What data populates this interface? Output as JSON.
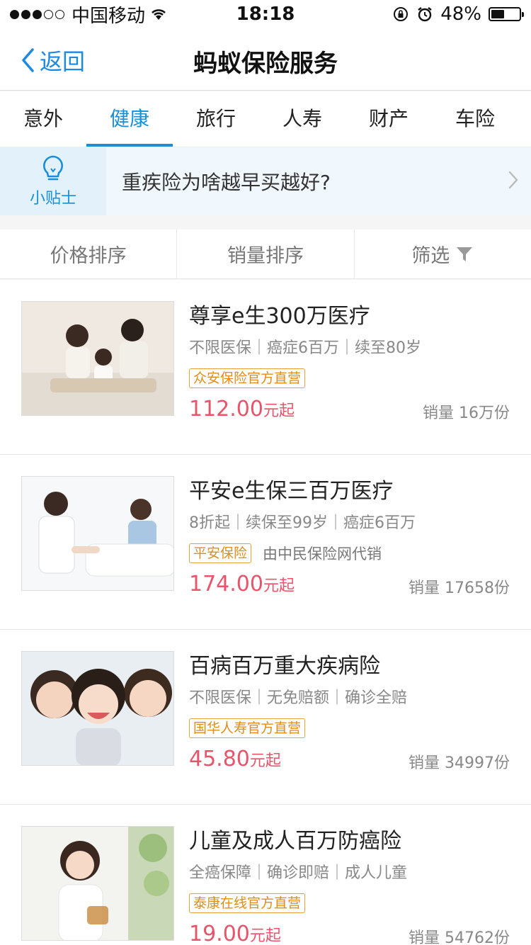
{
  "status_bar": {
    "carrier": "中国移动",
    "time": "18:18",
    "battery_text": "48%",
    "battery_level": 0.48
  },
  "nav": {
    "back_label": "返回",
    "title": "蚂蚁保险服务"
  },
  "tabs": [
    {
      "label": "意外",
      "active": false
    },
    {
      "label": "健康",
      "active": true
    },
    {
      "label": "旅行",
      "active": false
    },
    {
      "label": "人寿",
      "active": false
    },
    {
      "label": "财产",
      "active": false
    },
    {
      "label": "车险",
      "active": false
    }
  ],
  "tip": {
    "badge_label": "小贴士",
    "text": "重疾险为啥越早买越好?"
  },
  "sort": {
    "price_label": "价格排序",
    "sales_label": "销量排序",
    "filter_label": "筛选"
  },
  "products": [
    {
      "title": "尊享e生300万医疗",
      "features": "不限医保｜癌症6百万｜续至80岁",
      "tag": "众安保险官方直营",
      "agent": "",
      "price": "112.00",
      "price_suffix": "元起",
      "sales": "销量 16万份"
    },
    {
      "title": "平安e生保三百万医疗",
      "features": "8折起｜续保至99岁｜癌症6百万",
      "tag": "平安保险",
      "agent": "由中民保险网代销",
      "price": "174.00",
      "price_suffix": "元起",
      "sales": "销量 17658份"
    },
    {
      "title": "百病百万重大疾病险",
      "features": "不限医保｜无免赔额｜确诊全赔",
      "tag": "国华人寿官方直营",
      "agent": "",
      "price": "45.80",
      "price_suffix": "元起",
      "sales": "销量 34997份"
    },
    {
      "title": "儿童及成人百万防癌险",
      "features": "全癌保障｜确诊即赔｜成人儿童",
      "tag": "泰康在线官方直营",
      "agent": "",
      "price": "19.00",
      "price_suffix": "元起",
      "sales": "销量 54762份"
    }
  ],
  "colors": {
    "accent": "#1a8fd8",
    "price": "#e8556b",
    "tag": "#e08c1a"
  }
}
